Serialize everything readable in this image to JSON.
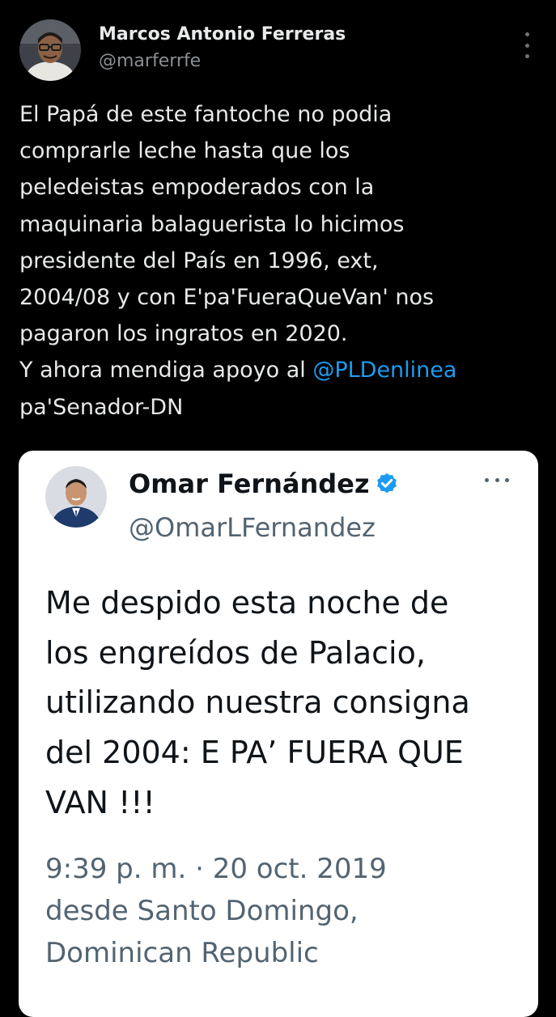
{
  "post": {
    "author": {
      "name": "Marcos Antonio Ferreras",
      "handle": "@marferrfe",
      "avatar_icon": "user-avatar-photo"
    },
    "menu_icon": "more-vertical-icon",
    "text_lines": [
      "El Papá de este fantoche no podia",
      "comprarle leche hasta que los",
      "peledeistas empoderados con la",
      "maquinaria balaguerista lo hicimos",
      "presidente del País en 1996, ext,",
      "2004/08 y con E'pa'FueraQueVan' nos",
      "pagaron los ingratos en 2020."
    ],
    "mention_line_prefix": "Y ahora mendiga apoyo al ",
    "mention": "@PLDenlinea",
    "last_line": "pa'Senador-DN"
  },
  "quoted": {
    "name": "Omar Fernández",
    "handle": "@OmarLFernandez",
    "verified_icon": "verified-badge-icon",
    "menu_icon": "more-horizontal-icon",
    "text_lines": [
      "Me despido esta noche de",
      "los engreídos de Palacio,",
      "utilizando nuestra consigna",
      "del 2004: E PA’ FUERA QUE",
      "VAN !!!"
    ],
    "meta_lines": [
      "9:39 p. m. · 20 oct. 2019",
      "desde Santo Domingo,",
      "Dominican Republic"
    ]
  },
  "colors": {
    "background": "#000000",
    "text_primary": "#e7e9ea",
    "text_secondary": "#8b8f94",
    "mention": "#1d9bf0",
    "card_background": "#ffffff",
    "verified": "#1d9bf0"
  }
}
